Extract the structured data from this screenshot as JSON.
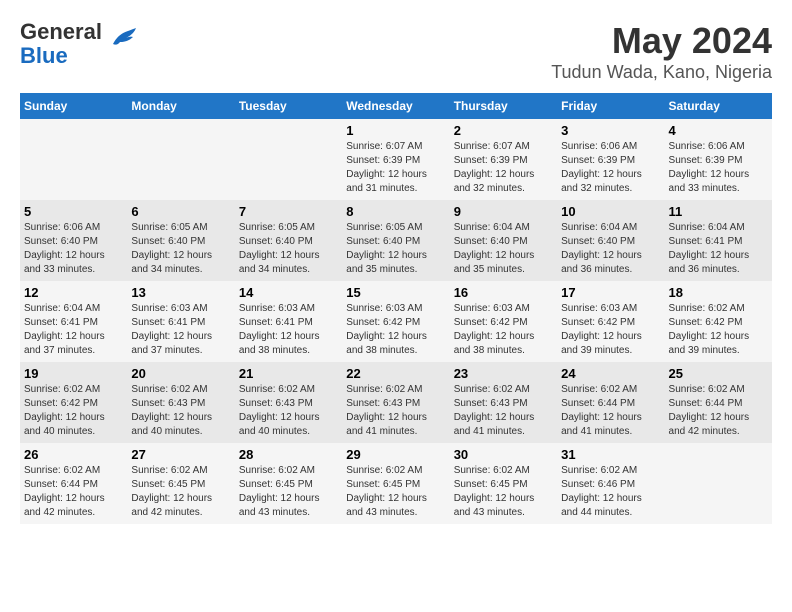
{
  "header": {
    "logo_general": "General",
    "logo_blue": "Blue",
    "month_title": "May 2024",
    "location": "Tudun Wada, Kano, Nigeria"
  },
  "weekdays": [
    "Sunday",
    "Monday",
    "Tuesday",
    "Wednesday",
    "Thursday",
    "Friday",
    "Saturday"
  ],
  "weeks": [
    [
      {
        "day": "",
        "info": ""
      },
      {
        "day": "",
        "info": ""
      },
      {
        "day": "",
        "info": ""
      },
      {
        "day": "1",
        "info": "Sunrise: 6:07 AM\nSunset: 6:39 PM\nDaylight: 12 hours\nand 31 minutes."
      },
      {
        "day": "2",
        "info": "Sunrise: 6:07 AM\nSunset: 6:39 PM\nDaylight: 12 hours\nand 32 minutes."
      },
      {
        "day": "3",
        "info": "Sunrise: 6:06 AM\nSunset: 6:39 PM\nDaylight: 12 hours\nand 32 minutes."
      },
      {
        "day": "4",
        "info": "Sunrise: 6:06 AM\nSunset: 6:39 PM\nDaylight: 12 hours\nand 33 minutes."
      }
    ],
    [
      {
        "day": "5",
        "info": "Sunrise: 6:06 AM\nSunset: 6:40 PM\nDaylight: 12 hours\nand 33 minutes."
      },
      {
        "day": "6",
        "info": "Sunrise: 6:05 AM\nSunset: 6:40 PM\nDaylight: 12 hours\nand 34 minutes."
      },
      {
        "day": "7",
        "info": "Sunrise: 6:05 AM\nSunset: 6:40 PM\nDaylight: 12 hours\nand 34 minutes."
      },
      {
        "day": "8",
        "info": "Sunrise: 6:05 AM\nSunset: 6:40 PM\nDaylight: 12 hours\nand 35 minutes."
      },
      {
        "day": "9",
        "info": "Sunrise: 6:04 AM\nSunset: 6:40 PM\nDaylight: 12 hours\nand 35 minutes."
      },
      {
        "day": "10",
        "info": "Sunrise: 6:04 AM\nSunset: 6:40 PM\nDaylight: 12 hours\nand 36 minutes."
      },
      {
        "day": "11",
        "info": "Sunrise: 6:04 AM\nSunset: 6:41 PM\nDaylight: 12 hours\nand 36 minutes."
      }
    ],
    [
      {
        "day": "12",
        "info": "Sunrise: 6:04 AM\nSunset: 6:41 PM\nDaylight: 12 hours\nand 37 minutes."
      },
      {
        "day": "13",
        "info": "Sunrise: 6:03 AM\nSunset: 6:41 PM\nDaylight: 12 hours\nand 37 minutes."
      },
      {
        "day": "14",
        "info": "Sunrise: 6:03 AM\nSunset: 6:41 PM\nDaylight: 12 hours\nand 38 minutes."
      },
      {
        "day": "15",
        "info": "Sunrise: 6:03 AM\nSunset: 6:42 PM\nDaylight: 12 hours\nand 38 minutes."
      },
      {
        "day": "16",
        "info": "Sunrise: 6:03 AM\nSunset: 6:42 PM\nDaylight: 12 hours\nand 38 minutes."
      },
      {
        "day": "17",
        "info": "Sunrise: 6:03 AM\nSunset: 6:42 PM\nDaylight: 12 hours\nand 39 minutes."
      },
      {
        "day": "18",
        "info": "Sunrise: 6:02 AM\nSunset: 6:42 PM\nDaylight: 12 hours\nand 39 minutes."
      }
    ],
    [
      {
        "day": "19",
        "info": "Sunrise: 6:02 AM\nSunset: 6:42 PM\nDaylight: 12 hours\nand 40 minutes."
      },
      {
        "day": "20",
        "info": "Sunrise: 6:02 AM\nSunset: 6:43 PM\nDaylight: 12 hours\nand 40 minutes."
      },
      {
        "day": "21",
        "info": "Sunrise: 6:02 AM\nSunset: 6:43 PM\nDaylight: 12 hours\nand 40 minutes."
      },
      {
        "day": "22",
        "info": "Sunrise: 6:02 AM\nSunset: 6:43 PM\nDaylight: 12 hours\nand 41 minutes."
      },
      {
        "day": "23",
        "info": "Sunrise: 6:02 AM\nSunset: 6:43 PM\nDaylight: 12 hours\nand 41 minutes."
      },
      {
        "day": "24",
        "info": "Sunrise: 6:02 AM\nSunset: 6:44 PM\nDaylight: 12 hours\nand 41 minutes."
      },
      {
        "day": "25",
        "info": "Sunrise: 6:02 AM\nSunset: 6:44 PM\nDaylight: 12 hours\nand 42 minutes."
      }
    ],
    [
      {
        "day": "26",
        "info": "Sunrise: 6:02 AM\nSunset: 6:44 PM\nDaylight: 12 hours\nand 42 minutes."
      },
      {
        "day": "27",
        "info": "Sunrise: 6:02 AM\nSunset: 6:45 PM\nDaylight: 12 hours\nand 42 minutes."
      },
      {
        "day": "28",
        "info": "Sunrise: 6:02 AM\nSunset: 6:45 PM\nDaylight: 12 hours\nand 43 minutes."
      },
      {
        "day": "29",
        "info": "Sunrise: 6:02 AM\nSunset: 6:45 PM\nDaylight: 12 hours\nand 43 minutes."
      },
      {
        "day": "30",
        "info": "Sunrise: 6:02 AM\nSunset: 6:45 PM\nDaylight: 12 hours\nand 43 minutes."
      },
      {
        "day": "31",
        "info": "Sunrise: 6:02 AM\nSunset: 6:46 PM\nDaylight: 12 hours\nand 44 minutes."
      },
      {
        "day": "",
        "info": ""
      }
    ]
  ]
}
